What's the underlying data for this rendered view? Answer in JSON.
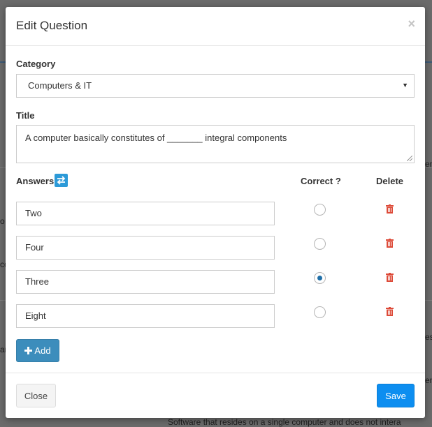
{
  "background": {
    "footer_text": "Software that resides on a single computer and does not intera"
  },
  "modal": {
    "title": "Edit Question",
    "close_symbol": "×"
  },
  "form": {
    "category_label": "Category",
    "category_value": "Computers & IT",
    "title_label": "Title",
    "title_value": "A computer basically constitutes of _______ integral components",
    "answers_label": "Answers",
    "correct_header": "Correct ?",
    "delete_header": "Delete",
    "answers": [
      {
        "text": "Two",
        "correct": false
      },
      {
        "text": "Four",
        "correct": false
      },
      {
        "text": "Three",
        "correct": true
      },
      {
        "text": "Eight",
        "correct": false
      }
    ],
    "add_label": "Add"
  },
  "footer": {
    "close_label": "Close",
    "save_label": "Save"
  },
  "colors": {
    "primary": "#3c8dbc",
    "save": "#0d8ef0",
    "delete": "#dd4b39",
    "radio_checked": "#1f6fa8"
  },
  "icons": {
    "swap": "swap-arrows-icon",
    "trash": "trash-icon",
    "plus": "plus-icon"
  }
}
